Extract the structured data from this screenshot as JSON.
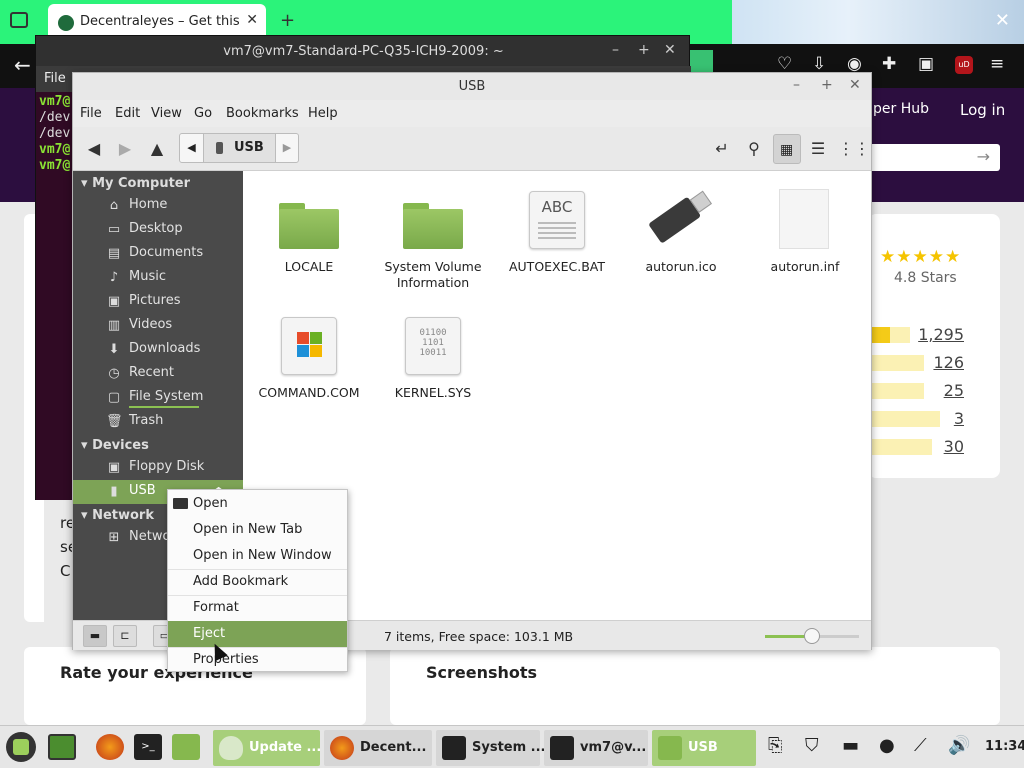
{
  "firefox": {
    "tab_title": "Decentraleyes – Get this Ex",
    "header_link": "per Hub",
    "login": "Log in",
    "rating_label": "4.8 Stars",
    "ratings": [
      {
        "count": "1,295",
        "fill": 0.33
      },
      {
        "count": "126",
        "fill": 0.0
      },
      {
        "count": "25",
        "fill": 0.0
      },
      {
        "count": "3",
        "fill": 0.0
      },
      {
        "count": "30",
        "fill": 0.0
      }
    ],
    "rate_heading": "Rate your experience",
    "screenshots_heading": "Screenshots",
    "fragments": [
      "re",
      "se",
      "C"
    ]
  },
  "terminal": {
    "title": "vm7@vm7-Standard-PC-Q35-ICH9-2009: ~",
    "menu_file": "File",
    "lines": [
      "vm7@",
      "/dev",
      "/dev",
      "vm7@",
      "vm7@"
    ]
  },
  "nemo": {
    "title": "USB",
    "menu": [
      "File",
      "Edit",
      "View",
      "Go",
      "Bookmarks",
      "Help"
    ],
    "path": "USB",
    "sidebar": {
      "my_computer": "My Computer",
      "places": [
        {
          "label": "Home",
          "icon": "home-icon"
        },
        {
          "label": "Desktop",
          "icon": "desktop-icon"
        },
        {
          "label": "Documents",
          "icon": "documents-icon"
        },
        {
          "label": "Music",
          "icon": "music-icon"
        },
        {
          "label": "Pictures",
          "icon": "pictures-icon"
        },
        {
          "label": "Videos",
          "icon": "videos-icon"
        },
        {
          "label": "Downloads",
          "icon": "downloads-icon"
        },
        {
          "label": "Recent",
          "icon": "recent-icon"
        },
        {
          "label": "File System",
          "icon": "filesystem-icon"
        },
        {
          "label": "Trash",
          "icon": "trash-icon"
        }
      ],
      "devices": "Devices",
      "device_items": [
        {
          "label": "Floppy Disk",
          "icon": "floppy-icon"
        },
        {
          "label": "USB",
          "icon": "usb-icon"
        }
      ],
      "network": "Network",
      "network_item": "Netwo"
    },
    "files": [
      {
        "name": "LOCALE",
        "type": "folder"
      },
      {
        "name": "System Volume Information",
        "type": "folder"
      },
      {
        "name": "AUTOEXEC.BAT",
        "type": "text",
        "glyph": "ABC"
      },
      {
        "name": "autorun.ico",
        "type": "usb"
      },
      {
        "name": "autorun.inf",
        "type": "blank"
      },
      {
        "name": "COMMAND.COM",
        "type": "exe"
      },
      {
        "name": "KERNEL.SYS",
        "type": "binary",
        "glyph": "01100 1101 10011"
      }
    ],
    "status": "7 items, Free space: 103.1 MB",
    "zoom_level": 0.5
  },
  "context_menu": {
    "items": [
      "Open",
      "Open in New Tab",
      "Open in New Window",
      "Add Bookmark",
      "Format",
      "Eject",
      "Properties"
    ],
    "highlighted": "Eject"
  },
  "taskbar": {
    "tasks": [
      "Update ...",
      "Decent...",
      "System ...",
      "vm7@v...",
      "USB"
    ],
    "clock": "11:34"
  },
  "colors": {
    "mint_green": "#7da356",
    "firefox_tab_bar": "#2bf37a",
    "page_header": "#2c0e3f",
    "star": "#f5c400"
  }
}
